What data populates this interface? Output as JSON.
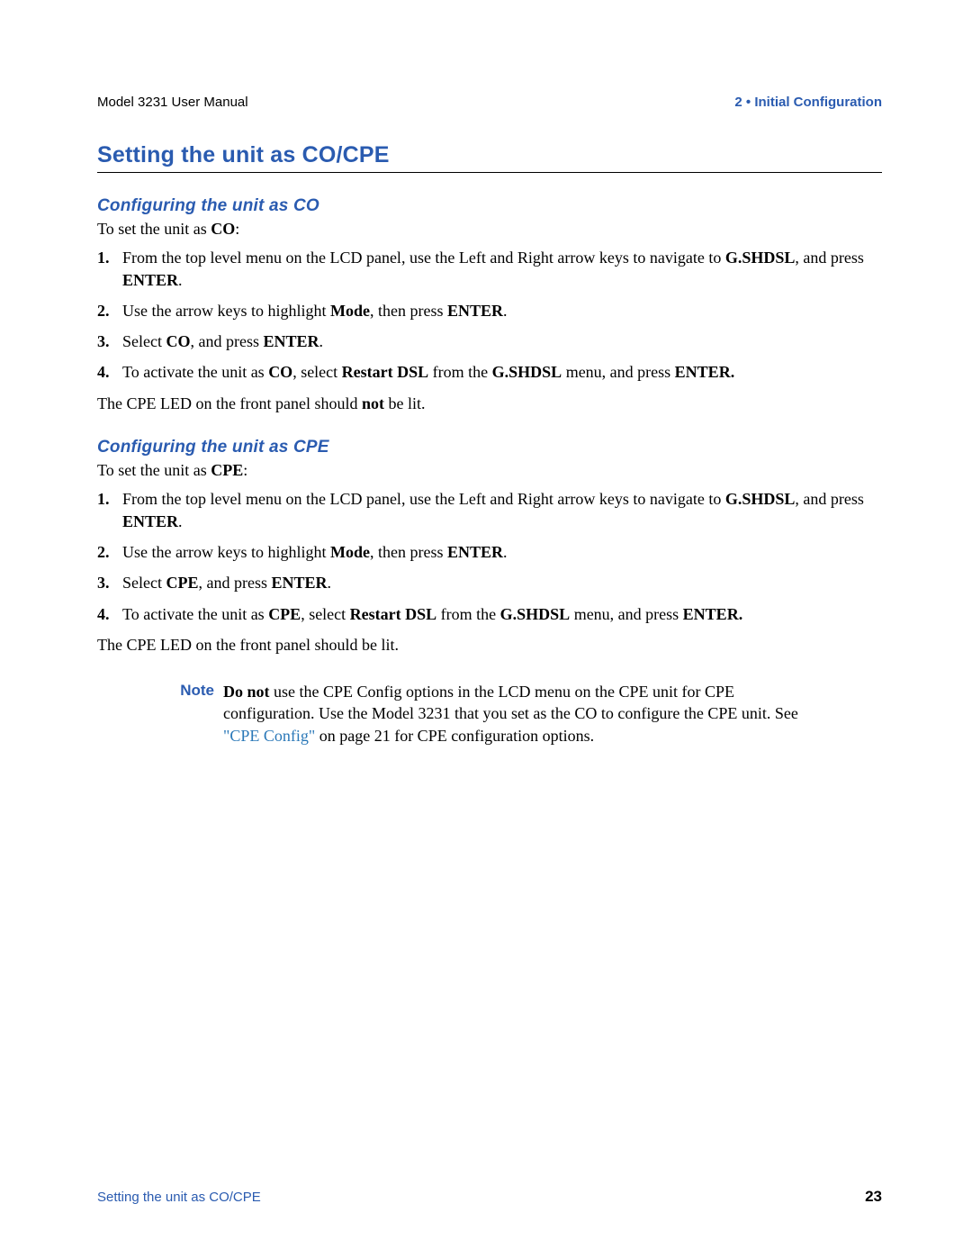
{
  "header": {
    "left": "Model 3231 User Manual",
    "right": "2 • Initial Configuration"
  },
  "mainHeading": "Setting the unit as CO/CPE",
  "sectionCO": {
    "heading": "Configuring the unit as CO",
    "intro_a": "To set the unit as ",
    "intro_b": "CO",
    "intro_c": ":",
    "steps": {
      "s1_a": "From the top level menu on the LCD panel, use the Left and Right arrow keys to navigate to ",
      "s1_b": "G.SHDSL",
      "s1_c": ", and press ",
      "s1_d": "ENTER",
      "s1_e": ".",
      "s2_a": "Use the arrow keys to highlight ",
      "s2_b": "Mode",
      "s2_c": ", then press ",
      "s2_d": "ENTER",
      "s2_e": ".",
      "s3_a": "Select ",
      "s3_b": "CO",
      "s3_c": ", and press ",
      "s3_d": "ENTER",
      "s3_e": ".",
      "s4_a": "To activate the unit as ",
      "s4_b": "CO",
      "s4_c": ", select ",
      "s4_d": "Restart DSL",
      "s4_e": " from the ",
      "s4_f": "G.SHDSL",
      "s4_g": " menu, and press ",
      "s4_h": "ENTER.",
      "s4_i": ""
    },
    "after_a": "The CPE LED on the front panel should ",
    "after_b": "not",
    "after_c": " be lit."
  },
  "sectionCPE": {
    "heading": "Configuring the unit as CPE",
    "intro_a": "To set the unit as ",
    "intro_b": "CPE",
    "intro_c": ":",
    "steps": {
      "s1_a": "From the top level menu on the LCD panel, use the Left and Right arrow keys to navigate to ",
      "s1_b": "G.SHDSL",
      "s1_c": ", and press ",
      "s1_d": "ENTER",
      "s1_e": ".",
      "s2_a": "Use the arrow keys to highlight ",
      "s2_b": "Mode",
      "s2_c": ", then press ",
      "s2_d": "ENTER",
      "s2_e": ".",
      "s3_a": "Select ",
      "s3_b": "CPE",
      "s3_c": ", and press ",
      "s3_d": "ENTER",
      "s3_e": ".",
      "s4_a": "To activate the unit as ",
      "s4_b": "CPE",
      "s4_c": ", select ",
      "s4_d": "Restart DSL",
      "s4_e": " from the ",
      "s4_f": "G.SHDSL",
      "s4_g": " menu, and press ",
      "s4_h": "ENTER.",
      "s4_i": ""
    },
    "after": "The CPE LED on the front panel should be lit."
  },
  "note": {
    "label": "Note",
    "b1": "Do not",
    "t1": " use the CPE Config options in the LCD menu on the CPE unit for CPE configuration. Use the Model 3231 that you set as the CO to configure the CPE unit. See ",
    "link": "\"CPE Config\"",
    "t2": " on page 21 for CPE configuration options."
  },
  "footer": {
    "left": "Setting the unit as CO/CPE",
    "page": "23"
  }
}
